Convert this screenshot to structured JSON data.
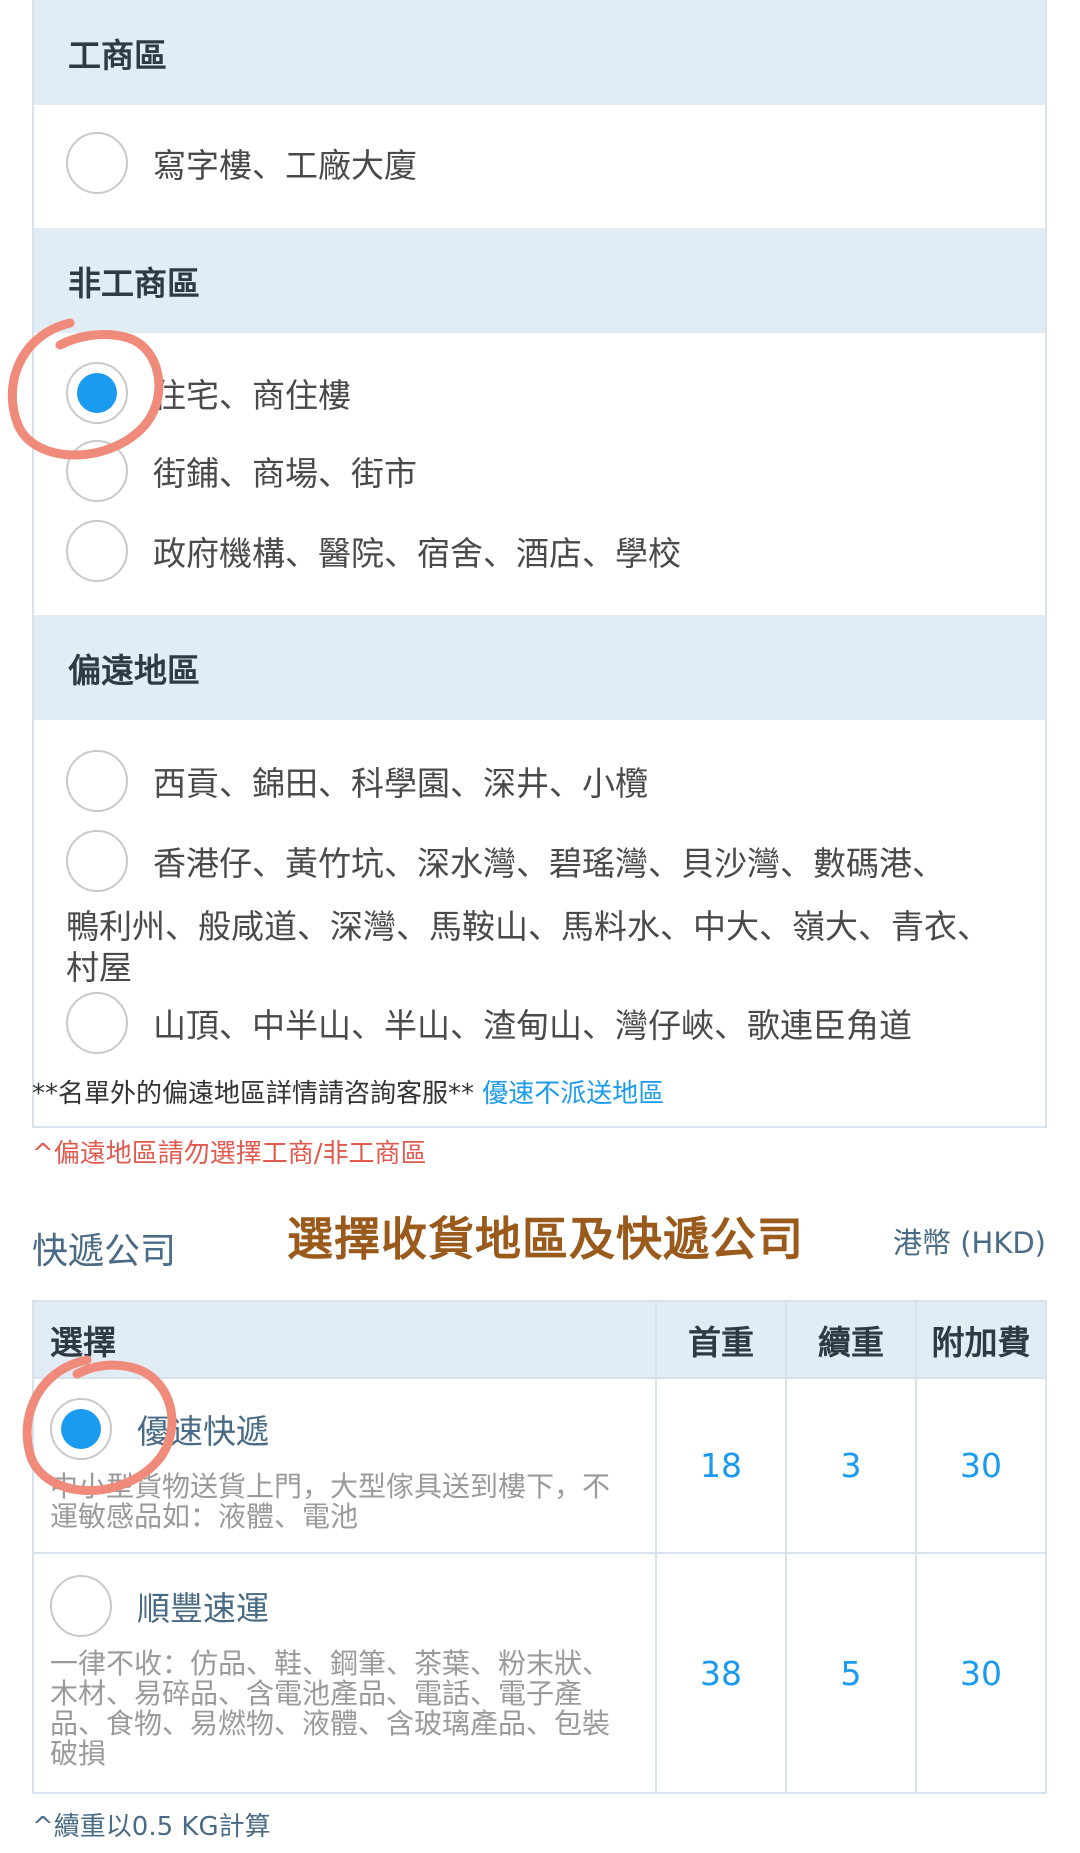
{
  "sections": {
    "industrial": {
      "header": "工商區",
      "options": [
        "寫字樓、工廠大廈"
      ]
    },
    "non_industrial": {
      "header": "非工商區",
      "options": [
        "住宅、商住樓",
        "街鋪、商場、街市",
        "政府機構、醫院、宿舍、酒店、學校"
      ]
    },
    "remote": {
      "header": "偏遠地區",
      "options": [
        "西貢、錦田、科學園、深井、小欖",
        "香港仔、黃竹坑、深水灣、碧瑤灣、貝沙灣、數碼港、",
        "山頂、中半山、半山、渣甸山、灣仔峽、歌連臣角道"
      ],
      "option2_cont": "鴨利州、般咸道、深灣、馬鞍山、馬料水、中大、嶺大、青衣、村屋",
      "note": "**名單外的偏遠地區詳情請咨詢客服**",
      "note_link": "優速不派送地區"
    }
  },
  "warning": "^偏遠地區請勿選擇工商/非工商區",
  "courier": {
    "title": "快遞公司",
    "overlay_title": "選擇收貨地區及快遞公司",
    "currency": "港幣 (HKD)",
    "columns": [
      "選擇",
      "首重",
      "續重",
      "附加費"
    ],
    "rows": [
      {
        "name": "優速快遞",
        "desc": "中小型貨物送貨上門，大型傢具送到樓下，不運敏感品如：液體、電池",
        "first": "18",
        "additional": "3",
        "surcharge": "30",
        "selected": true
      },
      {
        "name": "順豐速運",
        "desc": "一律不收：仿品、鞋、鋼筆、茶葉、粉末狀、木材、易碎品、含電池產品、電話、電子產品、食物、易燃物、液體、含玻璃產品、包裝破損",
        "first": "38",
        "additional": "5",
        "surcharge": "30",
        "selected": false
      }
    ]
  },
  "footnote": "^續重以0.5 KG計算",
  "colors": {
    "accent": "#1a9bf0",
    "header_bg": "#e2ecf5",
    "warning": "#e05a4e",
    "annotation": "#f08a7a",
    "overlay_title": "#9a5a1b"
  }
}
